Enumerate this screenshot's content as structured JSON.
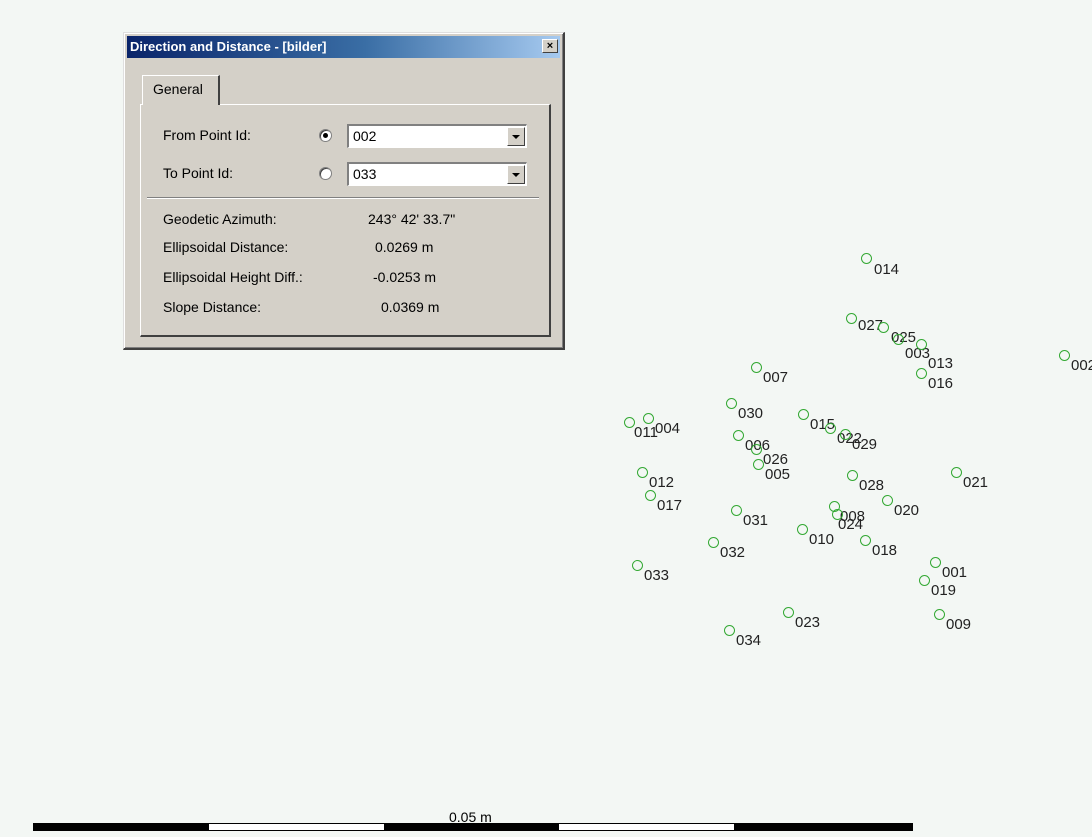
{
  "dialog": {
    "title": "Direction and Distance - [bilder]",
    "close_symbol": "×",
    "tab": "General",
    "from": {
      "label": "From Point Id:",
      "value": "002",
      "selected": true
    },
    "to": {
      "label": "To Point Id:",
      "value": "033",
      "selected": false
    },
    "results": [
      {
        "label": "Geodetic Azimuth:",
        "value": "243° 42' 33.7\""
      },
      {
        "label": "Ellipsoidal Distance:",
        "value": "0.0269 m"
      },
      {
        "label": "Ellipsoidal Height Diff.:",
        "value": "-0.0253 m"
      },
      {
        "label": "Slope Distance:",
        "value": "0.0369 m"
      }
    ]
  },
  "map": {
    "point_color": "#33a833",
    "points": [
      {
        "id": "014",
        "label": "014"
      },
      {
        "id": "027",
        "label": "027"
      },
      {
        "id": "025",
        "label": "025"
      },
      {
        "id": "003",
        "label": "003"
      },
      {
        "id": "013",
        "label": "013"
      },
      {
        "id": "016",
        "label": "016"
      },
      {
        "id": "002",
        "label": "002"
      },
      {
        "id": "007",
        "label": "007"
      },
      {
        "id": "030",
        "label": "030"
      },
      {
        "id": "015",
        "label": "015"
      },
      {
        "id": "022",
        "label": "022"
      },
      {
        "id": "029",
        "label": "029"
      },
      {
        "id": "011",
        "label": "011"
      },
      {
        "id": "004",
        "label": "004"
      },
      {
        "id": "006",
        "label": "006"
      },
      {
        "id": "026",
        "label": "026"
      },
      {
        "id": "005",
        "label": "005"
      },
      {
        "id": "012",
        "label": "012"
      },
      {
        "id": "017",
        "label": "017"
      },
      {
        "id": "028",
        "label": "028"
      },
      {
        "id": "021",
        "label": "021"
      },
      {
        "id": "008",
        "label": "008"
      },
      {
        "id": "024",
        "label": "024"
      },
      {
        "id": "020",
        "label": "020"
      },
      {
        "id": "031",
        "label": "031"
      },
      {
        "id": "010",
        "label": "010"
      },
      {
        "id": "018",
        "label": "018"
      },
      {
        "id": "032",
        "label": "032"
      },
      {
        "id": "001",
        "label": "001"
      },
      {
        "id": "019",
        "label": "019"
      },
      {
        "id": "033",
        "label": "033"
      },
      {
        "id": "023",
        "label": "023"
      },
      {
        "id": "009",
        "label": "009"
      },
      {
        "id": "034",
        "label": "034"
      }
    ]
  },
  "scale": {
    "label": "0.05 m"
  }
}
